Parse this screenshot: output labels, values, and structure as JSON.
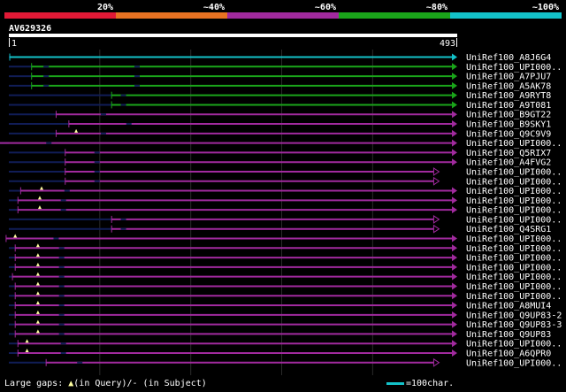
{
  "query": {
    "id": "AV629326",
    "start": "1",
    "end": "493",
    "length": 493
  },
  "color_scale": [
    {
      "label": "20%",
      "color": "#e21936"
    },
    {
      "label": "~40%",
      "color": "#e87222"
    },
    {
      "label": "~60%",
      "color": "#a12a9e"
    },
    {
      "label": "~80%",
      "color": "#1aa51a"
    },
    {
      "label": "~100%",
      "color": "#13c2c9"
    }
  ],
  "colors": {
    "blue": "#13c2c9",
    "green": "#1aa51a",
    "purple": "#a12a9e",
    "dark": "#111d57",
    "grid": "#2a2a2a",
    "gap": "#ffffa0"
  },
  "hits": [
    {
      "name": "UniRef100_A8J6G4",
      "start": 1,
      "end": 493,
      "color": "blue",
      "tip": "arrow",
      "gaps_q": [],
      "gaps_s": []
    },
    {
      "name": "UniRef100_UPI000..",
      "start": 25,
      "end": 493,
      "color": "green",
      "tip": "arrow",
      "gaps_q": [],
      "gaps_s": [
        41,
        141
      ]
    },
    {
      "name": "UniRef100_A7PJU7",
      "start": 25,
      "end": 493,
      "color": "green",
      "tip": "arrow",
      "gaps_q": [],
      "gaps_s": [
        41,
        141
      ]
    },
    {
      "name": "UniRef100_A5AK78",
      "start": 25,
      "end": 493,
      "color": "green",
      "tip": "arrow",
      "gaps_q": [],
      "gaps_s": [
        41,
        141
      ]
    },
    {
      "name": "UniRef100_A9RYT8",
      "start": 113,
      "end": 493,
      "color": "green",
      "tip": "arrow",
      "gaps_q": [],
      "gaps_s": [
        126
      ]
    },
    {
      "name": "UniRef100_A9T081",
      "start": 113,
      "end": 493,
      "color": "green",
      "tip": "arrow",
      "gaps_q": [],
      "gaps_s": [
        126
      ]
    },
    {
      "name": "UniRef100_B9GT22",
      "start": 52,
      "end": 493,
      "color": "purple",
      "tip": "arrow",
      "gaps_q": [],
      "gaps_s": [
        104
      ]
    },
    {
      "name": "UniRef100_B9SKY1",
      "start": 66,
      "end": 493,
      "color": "purple",
      "tip": "arrow",
      "gaps_q": [],
      "gaps_s": [
        132
      ]
    },
    {
      "name": "UniRef100_Q9C9V9",
      "start": 52,
      "end": 493,
      "color": "purple",
      "tip": "arrow",
      "gaps_q": [
        74
      ],
      "gaps_s": [
        104
      ]
    },
    {
      "name": "UniRef100_UPI000..",
      "start": -26,
      "end": 493,
      "color": "purple",
      "tip": "arrow",
      "gaps_q": [],
      "gaps_s": [
        44
      ]
    },
    {
      "name": "UniRef100_Q5RIX7",
      "start": 62,
      "end": 493,
      "color": "purple",
      "tip": "arrow",
      "gaps_q": [],
      "gaps_s": [
        97
      ]
    },
    {
      "name": "UniRef100_A4FVG2",
      "start": 62,
      "end": 493,
      "color": "purple",
      "tip": "arrow",
      "gaps_q": [],
      "gaps_s": [
        97
      ]
    },
    {
      "name": "UniRef100_UPI000..",
      "start": 62,
      "end": 473,
      "color": "purple",
      "tip": "open",
      "gaps_q": [],
      "gaps_s": [
        97
      ]
    },
    {
      "name": "UniRef100_UPI000..",
      "start": 62,
      "end": 473,
      "color": "purple",
      "tip": "open",
      "gaps_q": [],
      "gaps_s": [
        97
      ]
    },
    {
      "name": "UniRef100_UPI000..",
      "start": 13,
      "end": 493,
      "color": "purple",
      "tip": "arrow",
      "gaps_q": [
        36
      ],
      "gaps_s": [
        64
      ]
    },
    {
      "name": "UniRef100_UPI000..",
      "start": 10,
      "end": 493,
      "color": "purple",
      "tip": "arrow",
      "gaps_q": [
        34
      ],
      "gaps_s": [
        60
      ]
    },
    {
      "name": "UniRef100_UPI000..",
      "start": 10,
      "end": 493,
      "color": "purple",
      "tip": "arrow",
      "gaps_q": [
        34
      ],
      "gaps_s": [
        60
      ]
    },
    {
      "name": "UniRef100_UPI000..",
      "start": 113,
      "end": 473,
      "color": "purple",
      "tip": "open",
      "gaps_q": [],
      "gaps_s": [
        126
      ]
    },
    {
      "name": "UniRef100_Q4SRG1",
      "start": 113,
      "end": 473,
      "color": "purple",
      "tip": "open",
      "gaps_q": [],
      "gaps_s": [
        126
      ]
    },
    {
      "name": "UniRef100_UPI000..",
      "start": -3,
      "end": 493,
      "color": "purple",
      "tip": "arrow",
      "gaps_q": [
        7
      ],
      "gaps_s": [
        52
      ]
    },
    {
      "name": "UniRef100_UPI000..",
      "start": 7,
      "end": 493,
      "color": "purple",
      "tip": "arrow",
      "gaps_q": [
        32
      ],
      "gaps_s": [
        58
      ]
    },
    {
      "name": "UniRef100_UPI000..",
      "start": 7,
      "end": 493,
      "color": "purple",
      "tip": "arrow",
      "gaps_q": [
        32
      ],
      "gaps_s": [
        58
      ]
    },
    {
      "name": "UniRef100_UPI000..",
      "start": 7,
      "end": 493,
      "color": "purple",
      "tip": "arrow",
      "gaps_q": [
        32
      ],
      "gaps_s": [
        58
      ]
    },
    {
      "name": "UniRef100_UPI000..",
      "start": 4,
      "end": 493,
      "color": "purple",
      "tip": "arrow",
      "gaps_q": [
        32
      ],
      "gaps_s": [
        58
      ]
    },
    {
      "name": "UniRef100_UPI000..",
      "start": 7,
      "end": 493,
      "color": "purple",
      "tip": "arrow",
      "gaps_q": [
        32
      ],
      "gaps_s": [
        58
      ]
    },
    {
      "name": "UniRef100_UPI000..",
      "start": 7,
      "end": 493,
      "color": "purple",
      "tip": "arrow",
      "gaps_q": [
        32
      ],
      "gaps_s": [
        58
      ]
    },
    {
      "name": "UniRef100_A8MUI4",
      "start": 7,
      "end": 493,
      "color": "purple",
      "tip": "arrow",
      "gaps_q": [
        32
      ],
      "gaps_s": [
        58
      ]
    },
    {
      "name": "UniRef100_Q9UP83-2",
      "start": 7,
      "end": 493,
      "color": "purple",
      "tip": "arrow",
      "gaps_q": [
        32
      ],
      "gaps_s": [
        58
      ]
    },
    {
      "name": "UniRef100_Q9UP83-3",
      "start": 7,
      "end": 493,
      "color": "purple",
      "tip": "arrow",
      "gaps_q": [
        32
      ],
      "gaps_s": [
        58
      ]
    },
    {
      "name": "UniRef100_Q9UP83",
      "start": 7,
      "end": 493,
      "color": "purple",
      "tip": "arrow",
      "gaps_q": [
        32
      ],
      "gaps_s": [
        58
      ]
    },
    {
      "name": "UniRef100_UPI000..",
      "start": 10,
      "end": 493,
      "color": "purple",
      "tip": "arrow",
      "gaps_q": [
        20
      ],
      "gaps_s": [
        60
      ]
    },
    {
      "name": "UniRef100_A6QPR0",
      "start": 10,
      "end": 493,
      "color": "purple",
      "tip": "arrow",
      "gaps_q": [
        20
      ],
      "gaps_s": [
        60
      ]
    },
    {
      "name": "UniRef100_UPI000..",
      "start": 41,
      "end": 473,
      "color": "purple",
      "tip": "open",
      "gaps_q": [],
      "gaps_s": [
        78
      ]
    }
  ],
  "footer": {
    "gaps_prefix": "Large gaps: ",
    "gaps_query_symbol": "▲",
    "gaps_query_text": "(in Query)/- (in Subject)",
    "scale_text": "=100char."
  }
}
